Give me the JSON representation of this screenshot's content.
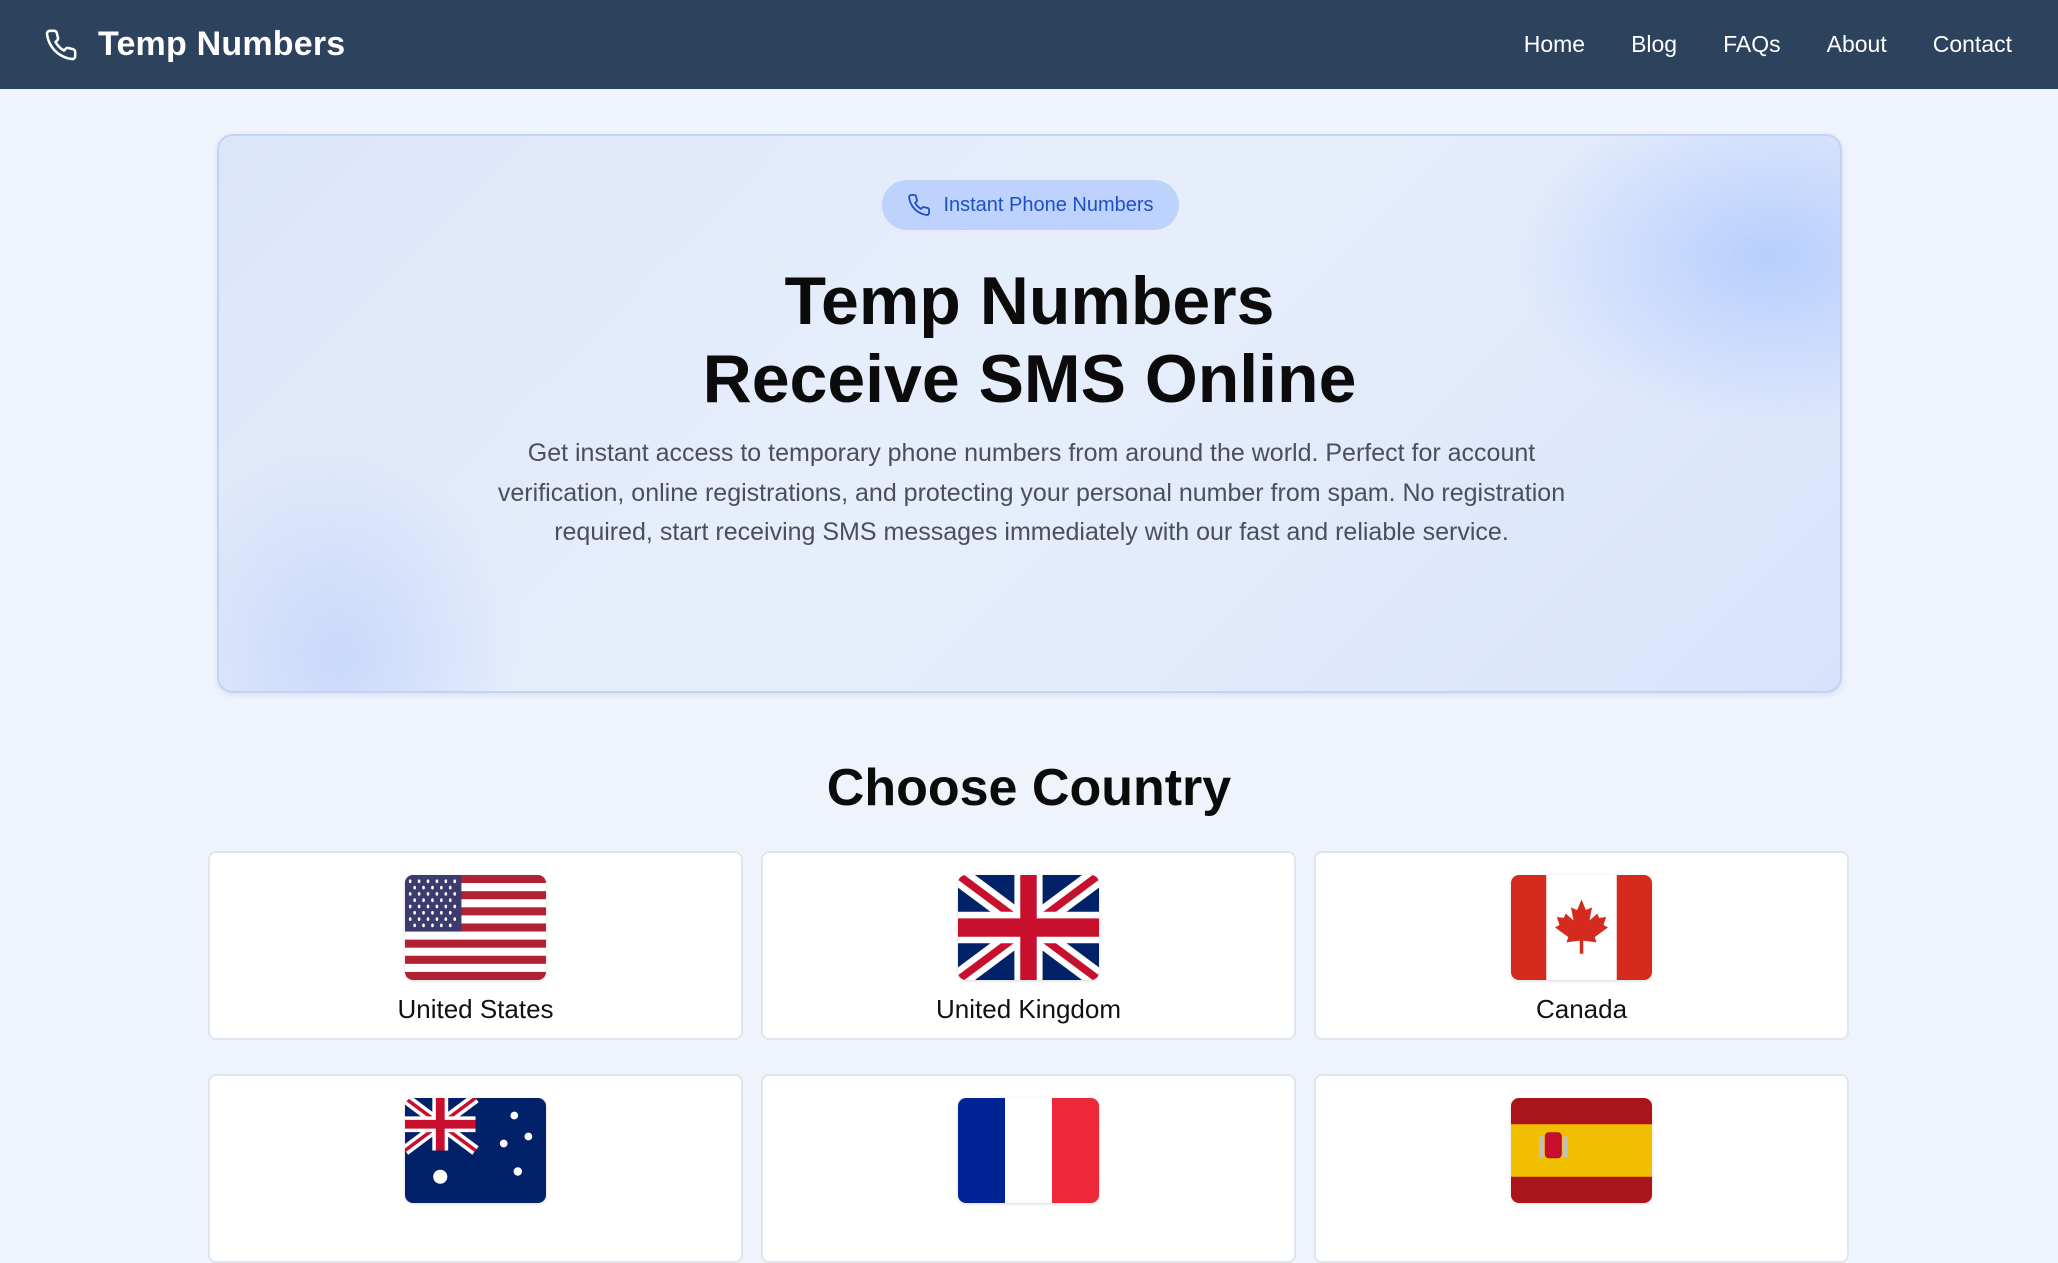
{
  "navbar": {
    "brand_icon": "phone-icon",
    "brand_name": "Temp Numbers",
    "links": [
      "Home",
      "Blog",
      "FAQs",
      "About",
      "Contact"
    ],
    "background": "#2d425c"
  },
  "hero": {
    "badge_icon": "phone-icon",
    "badge_label": "Instant Phone Numbers",
    "title_line1": "Temp Numbers",
    "title_line2": "Receive SMS Online",
    "description": "Get instant access to temporary phone numbers from around the world. Perfect for account verification, online registrations, and protecting your personal number from spam. No registration required, start receiving SMS messages immediately with our fast and reliable service."
  },
  "countries_section": {
    "title": "Choose Country",
    "countries": [
      {
        "name": "United States",
        "flag_icon": "us-flag-icon"
      },
      {
        "name": "United Kingdom",
        "flag_icon": "uk-flag-icon"
      },
      {
        "name": "Canada",
        "flag_icon": "canada-flag-icon"
      },
      {
        "name": "",
        "flag_icon": "australia-flag-icon"
      },
      {
        "name": "",
        "flag_icon": "france-flag-icon"
      },
      {
        "name": "",
        "flag_icon": "spain-flag-icon"
      }
    ]
  },
  "colors": {
    "page_background": "#eef3fc",
    "accent": "#1f4fc8",
    "badge_background": "#bdd2fc"
  }
}
